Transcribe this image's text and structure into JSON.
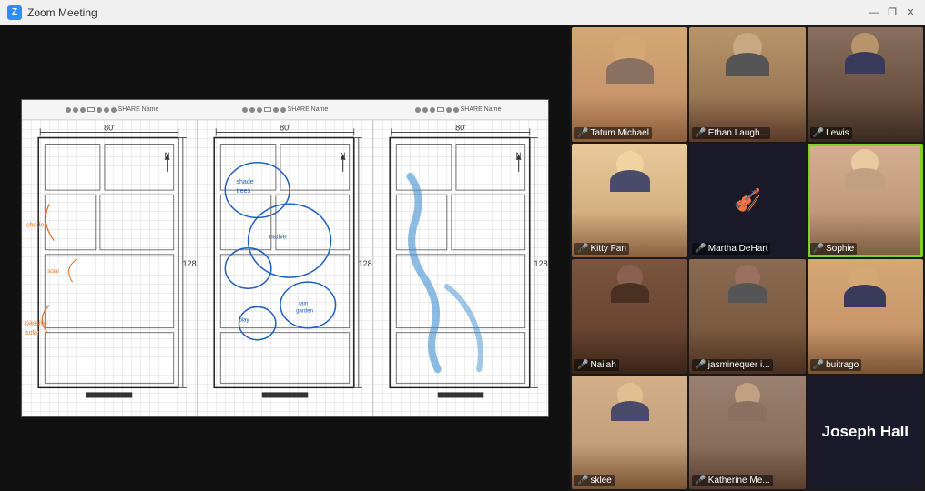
{
  "titleBar": {
    "title": "Zoom Meeting",
    "icon": "Z",
    "controls": {
      "minimize": "—",
      "maximize": "❐",
      "close": "✕"
    }
  },
  "whiteboard": {
    "panels": [
      {
        "id": "panel1",
        "dimension_width": "80'",
        "dimension_height": "128'"
      },
      {
        "id": "panel2",
        "dimension_width": "80'",
        "dimension_height": "128'"
      },
      {
        "id": "panel3",
        "dimension_width": "80'",
        "dimension_height": "128'"
      }
    ]
  },
  "participants": [
    {
      "id": "tatum",
      "name": "Tatum Michael",
      "nameShort": "Tatum Michael",
      "hasMic": true,
      "highlighted": false,
      "faceClass": "face-tatum",
      "emoji": "👩"
    },
    {
      "id": "ethan",
      "name": "Ethan Laugh...",
      "nameShort": "Ethan Laugh...",
      "hasMic": true,
      "highlighted": false,
      "faceClass": "face-ethan",
      "emoji": "👨"
    },
    {
      "id": "lewis",
      "name": "Lewis",
      "nameShort": "Lewis",
      "hasMic": true,
      "highlighted": false,
      "faceClass": "face-lewis",
      "emoji": "🧑"
    },
    {
      "id": "kitty",
      "name": "Kitty Fan",
      "nameShort": "Kitty Fan",
      "hasMic": true,
      "highlighted": false,
      "faceClass": "face-kitty",
      "emoji": "👩"
    },
    {
      "id": "martha",
      "name": "Martha DeHart",
      "nameShort": "Martha DeHart",
      "hasMic": true,
      "highlighted": false,
      "faceClass": "face-martha",
      "emoji": ""
    },
    {
      "id": "sophie",
      "name": "Sophie",
      "nameShort": "Sophie",
      "hasMic": true,
      "highlighted": true,
      "faceClass": "face-sophie",
      "emoji": "👩"
    },
    {
      "id": "nailah",
      "name": "Nailah",
      "nameShort": "Nailah",
      "hasMic": true,
      "highlighted": false,
      "faceClass": "face-nailah",
      "emoji": "👩"
    },
    {
      "id": "jasmine",
      "name": "jasminequer i...",
      "nameShort": "jasminequer i...",
      "hasMic": true,
      "highlighted": false,
      "faceClass": "face-jasmine",
      "emoji": "👩"
    },
    {
      "id": "buitrago",
      "name": "buitrago",
      "nameShort": "buitrago",
      "hasMic": true,
      "highlighted": false,
      "faceClass": "face-buitrago",
      "emoji": "👨"
    },
    {
      "id": "sklee",
      "name": "sklee",
      "nameShort": "sklee",
      "hasMic": true,
      "highlighted": false,
      "faceClass": "face-sklee",
      "emoji": "👩"
    },
    {
      "id": "katherine",
      "name": "Katherine Me...",
      "nameShort": "Katherine Me...",
      "hasMic": true,
      "highlighted": false,
      "faceClass": "face-katherine",
      "emoji": "👩"
    },
    {
      "id": "joseph",
      "name": "Joseph Hall",
      "nameShort": "Joseph Hall",
      "hasMic": true,
      "highlighted": false,
      "faceClass": "face-joseph",
      "isTextOnly": true
    }
  ]
}
